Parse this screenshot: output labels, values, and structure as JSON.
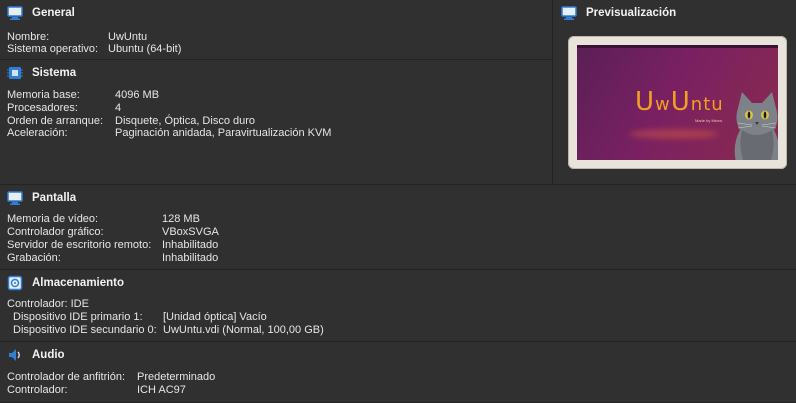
{
  "general": {
    "title": "General",
    "rows": [
      {
        "key": "Nombre:",
        "value": "UwUntu"
      },
      {
        "key": "Sistema operativo:",
        "value": "Ubuntu (64-bit)"
      }
    ]
  },
  "sistema": {
    "title": "Sistema",
    "rows": [
      {
        "key": "Memoria base:",
        "value": "4096 MB"
      },
      {
        "key": "Procesadores:",
        "value": "4"
      },
      {
        "key": "Orden de arranque:",
        "value": "Disquete, Óptica, Disco duro"
      },
      {
        "key": "Aceleración:",
        "value": "Paginación anidada, Paravirtualización KVM"
      }
    ]
  },
  "preview": {
    "title": "Previsualización",
    "screen_title_parts": [
      "U",
      "w",
      "U",
      "ntu"
    ],
    "screen_subtitle": "Made by Meow"
  },
  "pantalla": {
    "title": "Pantalla",
    "rows": [
      {
        "key": "Memoria de vídeo:",
        "value": "128 MB"
      },
      {
        "key": "Controlador gráfico:",
        "value": "VBoxSVGA"
      },
      {
        "key": "Servidor de escritorio remoto:",
        "value": "Inhabilitado"
      },
      {
        "key": "Grabación:",
        "value": "Inhabilitado"
      }
    ]
  },
  "almacenamiento": {
    "title": "Almacenamiento",
    "controller": "Controlador: IDE",
    "rows": [
      {
        "key": "Dispositivo IDE primario 1:",
        "value": "[Unidad óptica] Vacío"
      },
      {
        "key": "Dispositivo IDE secundario 0:",
        "value": "UwUntu.vdi (Normal, 100,00 GB)"
      }
    ]
  },
  "audio": {
    "title": "Audio",
    "rows": [
      {
        "key": "Controlador de anfitrión:",
        "value": "Predeterminado"
      },
      {
        "key": "Controlador:",
        "value": "ICH AC97"
      }
    ]
  },
  "colors": {
    "background": "#303030",
    "separator": "#232323",
    "text": "#e6e6e6",
    "accent_blue": "#2f7fd4",
    "preview_title": "#f2a024"
  }
}
